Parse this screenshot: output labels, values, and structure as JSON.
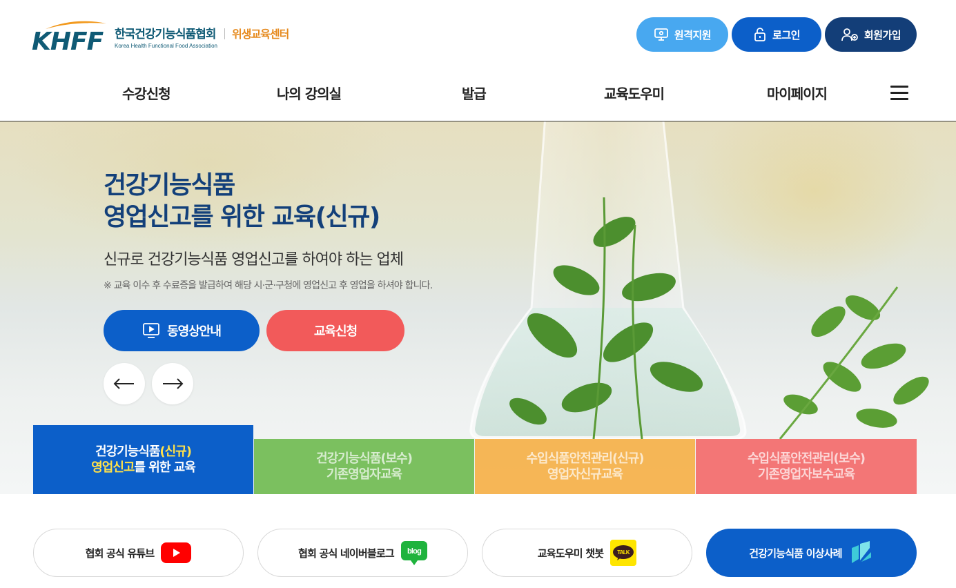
{
  "header": {
    "logo_letters": "KHFF",
    "logo_name_ko": "한국건강기능식품협회",
    "logo_name_en": "Korea Health Functional Food Association",
    "logo_center": "위생교육센터",
    "buttons": {
      "remote": "원격지원",
      "login": "로그인",
      "join": "회원가입"
    },
    "nav": [
      "수강신청",
      "나의 강의실",
      "발급",
      "교육도우미",
      "마이페이지"
    ]
  },
  "hero": {
    "title_line1": "건강기능식품",
    "title_line2": "영업신고를 위한 교육(신규)",
    "subtitle": "신규로 건강기능식품 영업신고를 하여야 하는 업체",
    "note": "※ 교육 이수 후 수료증을 발급하여 해당 시·군·구청에 영업신고 후 영업을 하셔야 합니다.",
    "video_button": "동영상안내",
    "apply_button": "교육신청"
  },
  "tabs": [
    {
      "line1_a": "건강기능식품",
      "line1_b": "(신규)",
      "line2_a": "영업신고",
      "line2_b": "를 위한 교육"
    },
    {
      "line1": "건강기능식품(보수)",
      "line2": "기존영업자교육"
    },
    {
      "line1": "수입식품안전관리(신규)",
      "line2": "영업자신규교육"
    },
    {
      "line1": "수입식품안전관리(보수)",
      "line2": "기존영업자보수교육"
    }
  ],
  "quick_links": {
    "youtube": "협회 공식 유튜브",
    "blog": "협회 공식 네이버블로그",
    "blog_icon_text": "blog",
    "chatbot": "교육도우미 챗봇",
    "talk_icon_text": "TALK",
    "cases": "건강기능식품 이상사례"
  },
  "colors": {
    "primary": "#0c5fc9",
    "navy": "#133e78",
    "sky": "#48a8f0",
    "coral": "#f25a5a",
    "green": "#6ab84a",
    "orange": "#f6aa3a",
    "red": "#f36464",
    "logo_teal": "#0f5a75",
    "logo_orange": "#e68a1e"
  }
}
